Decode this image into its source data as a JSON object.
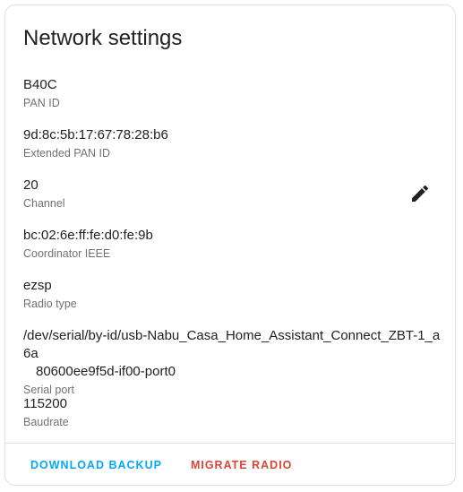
{
  "card": {
    "title": "Network settings"
  },
  "settings": {
    "pan_id": {
      "value": "B40C",
      "label": "PAN ID"
    },
    "extended_pan_id": {
      "value": "9d:8c:5b:17:67:78:28:b6",
      "label": "Extended PAN ID"
    },
    "channel": {
      "value": "20",
      "label": "Channel"
    },
    "coordinator_ieee": {
      "value": "bc:02:6e:ff:fe:d0:fe:9b",
      "label": "Coordinator IEEE"
    },
    "radio_type": {
      "value": "ezsp",
      "label": "Radio type"
    },
    "serial_port": {
      "value_line1": "/dev/serial/by-id/usb-Nabu_Casa_Home_Assistant_Connect_ZBT-1_a6a",
      "value_line2": "80600ee9f5d-if00-port0",
      "label": "Serial port"
    },
    "baudrate": {
      "value": "115200",
      "label": "Baudrate"
    }
  },
  "actions": {
    "download_backup": "DOWNLOAD BACKUP",
    "migrate_radio": "MIGRATE RADIO"
  },
  "icons": {
    "edit": "pencil-icon"
  },
  "colors": {
    "primary": "#03a9f4",
    "danger": "#db4437",
    "text": "#212121",
    "secondary_text": "#727272"
  }
}
